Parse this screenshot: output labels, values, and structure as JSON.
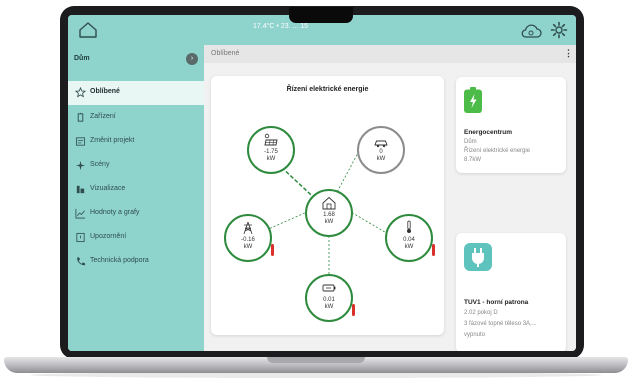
{
  "topbar": {
    "weather_text": "17.4°C • 23. ... 15",
    "accent_color": "#8fd3cd"
  },
  "sidebar": {
    "title": "Dům",
    "items": [
      {
        "label": "Oblíbené",
        "icon": "star-icon",
        "active": true
      },
      {
        "label": "Zařízení",
        "icon": "device-icon"
      },
      {
        "label": "Změnit projekt",
        "icon": "switch-project-icon"
      },
      {
        "label": "Scény",
        "icon": "scene-icon"
      },
      {
        "label": "Vizualizace",
        "icon": "visualization-icon"
      },
      {
        "label": "Hodnoty a grafy",
        "icon": "chart-icon"
      },
      {
        "label": "Upozornění",
        "icon": "notification-icon"
      },
      {
        "label": "Technická podpora",
        "icon": "phone-icon"
      }
    ]
  },
  "main": {
    "breadcrumb": "Oblíbené",
    "menu_glyph": "⋮",
    "energy_card": {
      "title": "Řízení elektrické energie",
      "nodes": {
        "solar": {
          "value": "-1.75",
          "unit": "kW"
        },
        "car": {
          "value": "0",
          "unit": "kW"
        },
        "house": {
          "value": "1.68",
          "unit": "kW"
        },
        "grid": {
          "value": "-0.16",
          "unit": "kW"
        },
        "heater": {
          "value": "0.04",
          "unit": "kW"
        },
        "battery": {
          "value": "0.01",
          "unit": "kW"
        }
      }
    },
    "energy_center": {
      "title": "Energocentrum",
      "line1": "Dům",
      "line2": "Řízení elektrické energie",
      "line3": "8.7kW"
    },
    "tuv_card": {
      "title": "TUV1 - horní patrona",
      "line1": "2.02 pokoj D",
      "line2": "3 fázové topné těleso 3A,...",
      "line3": "vypnuto"
    }
  }
}
